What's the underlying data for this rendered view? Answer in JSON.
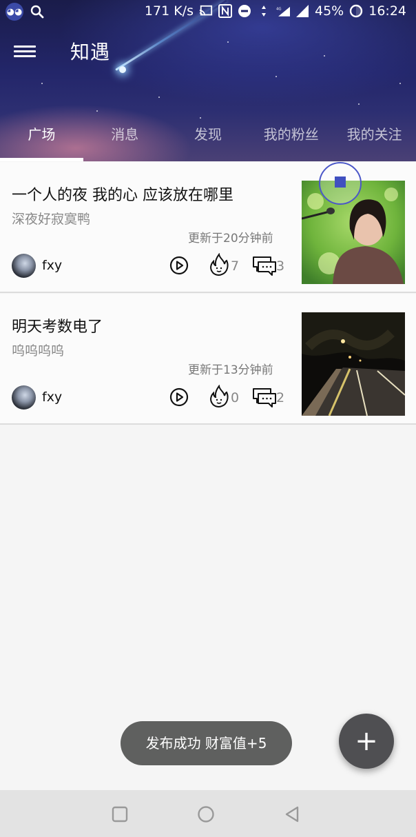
{
  "status_bar": {
    "speed": "171 K/s",
    "network": "4G",
    "battery": "45%",
    "time": "16:24",
    "icons": [
      "app-avatar-icon",
      "search-icon",
      "cast-icon",
      "nfc-icon",
      "do-not-disturb-icon",
      "data-arrows-icon",
      "signal-4g-icon",
      "signal-icon",
      "battery-icon"
    ]
  },
  "app_bar": {
    "title": "知遇",
    "menu_icon": "hamburger-menu-icon"
  },
  "tabs": [
    {
      "label": "广场",
      "active": true
    },
    {
      "label": "消息",
      "active": false
    },
    {
      "label": "发现",
      "active": false
    },
    {
      "label": "我的粉丝",
      "active": false
    },
    {
      "label": "我的关注",
      "active": false
    }
  ],
  "posts": [
    {
      "title": "一个人的夜 我的心 应该放在哪里",
      "subtitle": "深夜好寂寞鸭",
      "updated": "更新于20分钟前",
      "author": "fxy",
      "likes": "7",
      "comments": "3",
      "thumbnail": "girl-with-microphone-photo"
    },
    {
      "title": "明天考数电了",
      "subtitle": "呜呜呜呜",
      "updated": "更新于13分钟前",
      "author": "fxy",
      "likes": "0",
      "comments": "2",
      "thumbnail": "night-road-photo"
    }
  ],
  "toast": {
    "text": "发布成功 财富值+5"
  },
  "fab": {
    "label": "+",
    "icon": "plus-icon"
  },
  "nav_bar": {
    "icons": [
      "recent-apps-icon",
      "home-icon",
      "back-icon"
    ]
  },
  "colors": {
    "header_top": "#1a1c4a",
    "header_bottom": "#4a4075",
    "fab": "#4f4f52",
    "toast": "#5f605f",
    "page_bg": "#f5f5f5"
  }
}
